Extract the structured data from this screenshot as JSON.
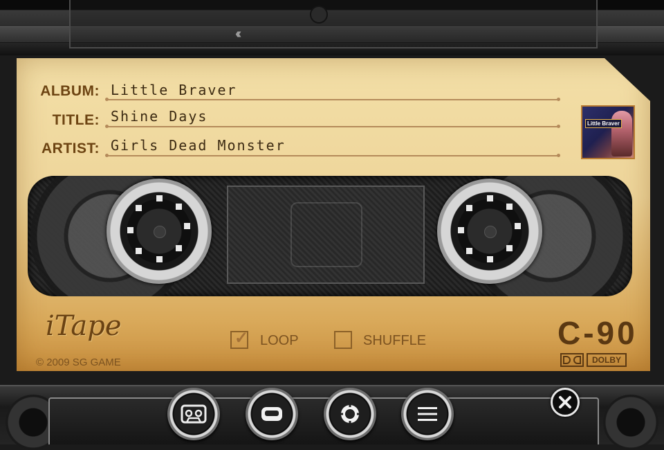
{
  "track": {
    "album_label": "ALBUM:",
    "album": "Little Braver",
    "title_label": "TITLE:",
    "title": "Shine Days",
    "artist_label": "ARTIST:",
    "artist": "Girls Dead Monster"
  },
  "album_art": {
    "caption": "Little Braver",
    "icon": "album-cover"
  },
  "options": {
    "loop_label": "LOOP",
    "loop_checked": true,
    "shuffle_label": "SHUFFLE",
    "shuffle_checked": false
  },
  "cassette": {
    "logo": "iTape",
    "copyright": "© 2009 SG GAME",
    "tape_type": "C-90",
    "noise_reduction": "DOLBY"
  },
  "controls": {
    "buttons": [
      {
        "icon": "cassette-icon"
      },
      {
        "icon": "stop-icon"
      },
      {
        "icon": "settings-icon"
      },
      {
        "icon": "menu-icon"
      }
    ],
    "close_icon": "close-icon"
  },
  "colors": {
    "label_paper": "#eed59a",
    "label_ink": "#6d4412",
    "deck": "#1b1b1b"
  }
}
